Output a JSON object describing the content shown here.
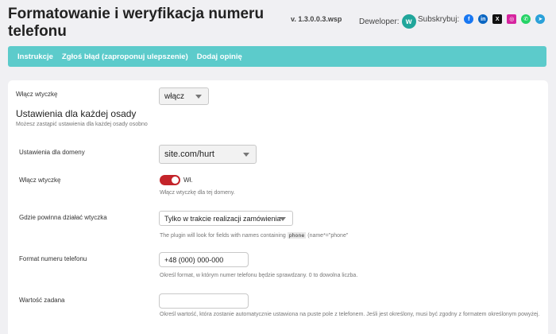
{
  "header": {
    "title": "Formatowanie i weryfikacja numeru telefonu",
    "version": "v. 1.3.0.0.3.wsp",
    "developer_label": "Deweloper:",
    "subscribe_label": "Subskrybuj:"
  },
  "nav": {
    "items": [
      "Instrukcje",
      "Zgłoś błąd (zaproponuj ulepszenie)",
      "Dodaj opinię"
    ]
  },
  "form": {
    "enable_plugin_label": "Włącz wtyczkę",
    "enable_plugin_value": "włącz",
    "per_site_heading": "Ustawienia dla każdej osady",
    "per_site_help": "Możesz zastąpić ustawienia dla każdej osady osobno",
    "domain_label": "Ustawienia dla domeny",
    "domain_value": "site.com/hurt",
    "domain_enable_label": "Włącz wtyczkę",
    "toggle_text": "Wł.",
    "toggle_help": "Włącz wtyczkę dla tej domeny.",
    "where_label": "Gdzie powinna działać wtyczka",
    "where_value": "Tylko w trakcie realizacji zamówienia",
    "where_help_pre": "The plugin will look for fields with names containing",
    "where_help_code": "phone",
    "where_help_post": "(name*=\"phone\"",
    "format_label": "Format numeru telefonu",
    "format_value": "+48 (000) 000-000",
    "format_help": "Określ format, w którym numer telefonu będzie sprawdzany. 0 to dowolna liczba.",
    "default_label": "Wartość zadana",
    "default_value": "",
    "default_help": "Określ wartość, która zostanie automatycznie ustawiona na puste pole z telefonem. Jeśli jest określony, musi być zgodny z formatem określonym powyżej."
  },
  "colors": {
    "nav_bg": "#5ccbcb",
    "toggle_on": "#c4242a",
    "dev_logo": "#21a69b"
  },
  "icons": {
    "social": [
      "facebook-icon",
      "linkedin-icon",
      "x-icon",
      "instagram-icon",
      "whatsapp-icon",
      "telegram-icon"
    ]
  }
}
